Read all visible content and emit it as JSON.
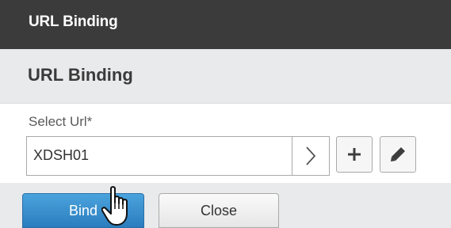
{
  "dialog": {
    "title": "URL Binding"
  },
  "section": {
    "title": "URL Binding"
  },
  "form": {
    "select_url_label": "Select Url*",
    "select_url_value": "XDSH01"
  },
  "icons": {
    "browse": "chevron-right-icon",
    "add": "plus-icon",
    "edit": "pencil-icon",
    "cursor": "hand-pointer-cursor-icon"
  },
  "footer": {
    "bind_label": "Bind",
    "close_label": "Close"
  },
  "colors": {
    "titlebar": "#3b3b3c",
    "primary": "#2b7dbd",
    "panel": "#e9eaeb"
  }
}
